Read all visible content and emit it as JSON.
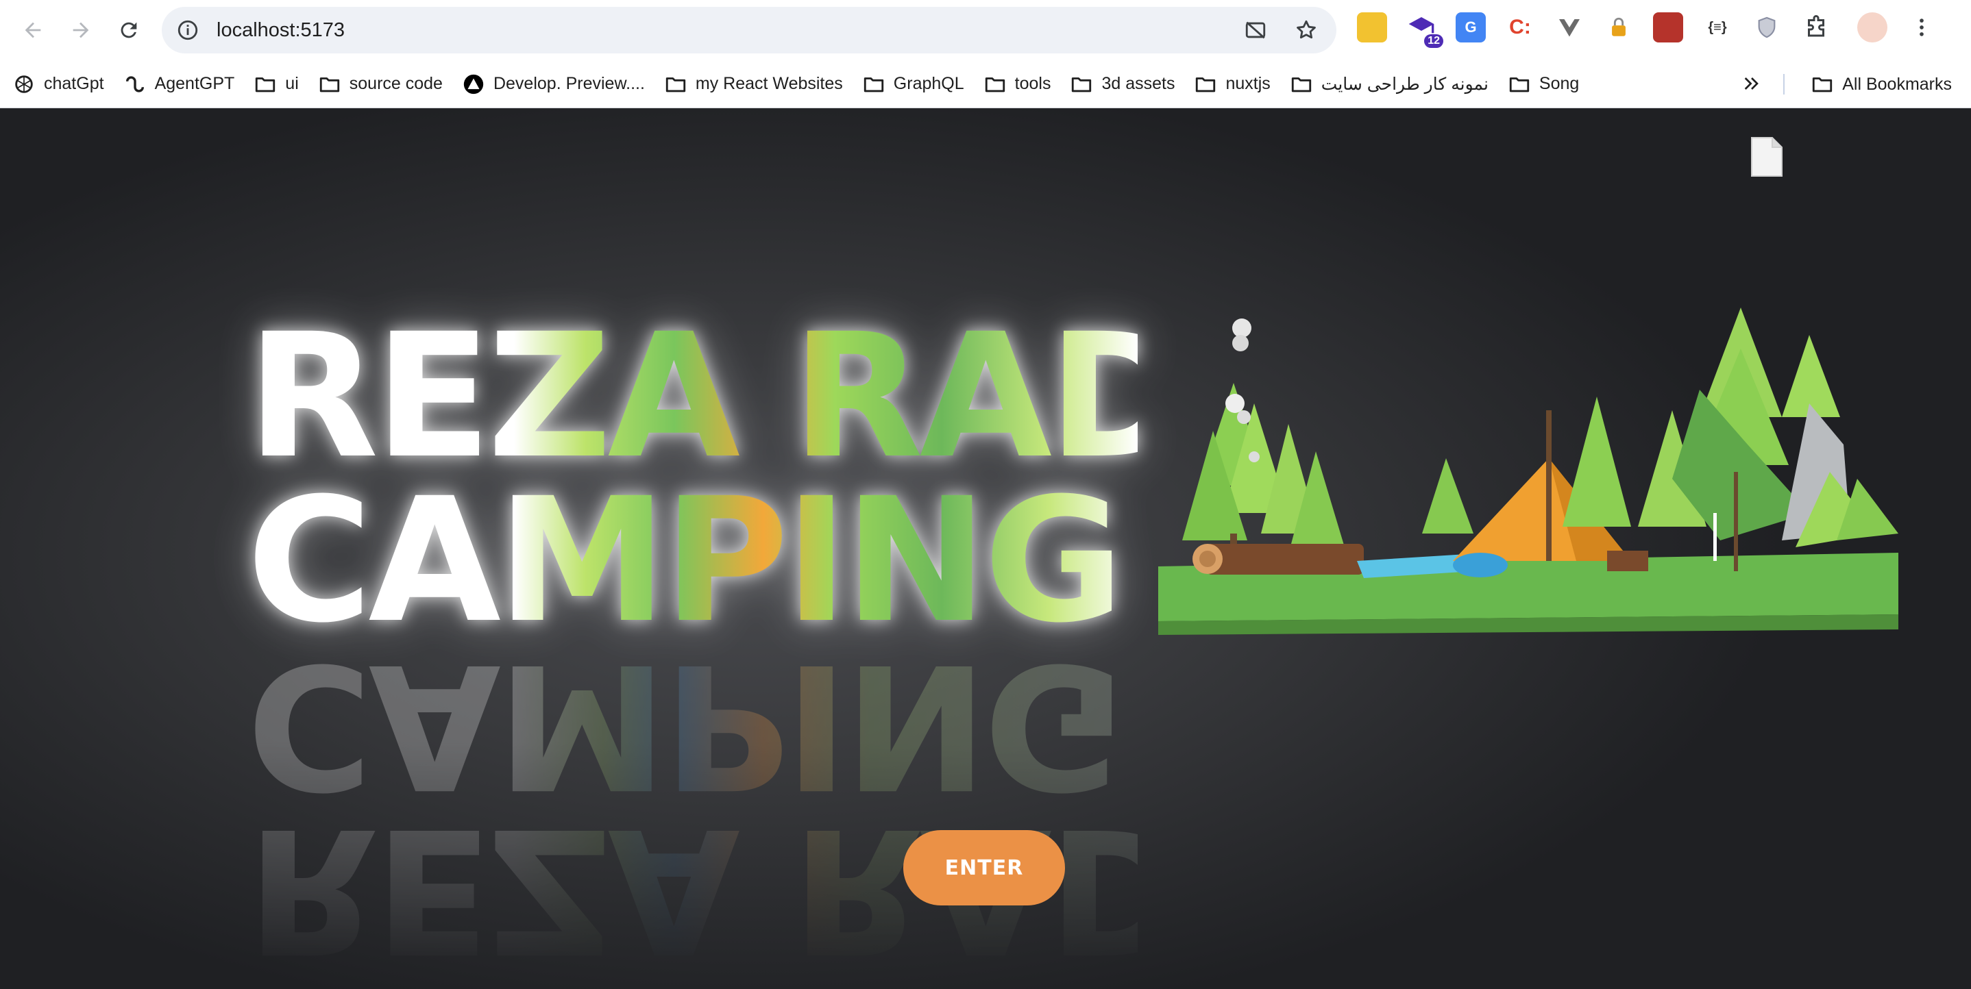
{
  "browser": {
    "url": "localhost:5173",
    "extensions": [
      {
        "name": "keep-extension-icon",
        "color": "#f2c230"
      },
      {
        "name": "graduation-extension-icon",
        "color": "#4e2bb5",
        "badge": "12"
      },
      {
        "name": "translate-extension-icon",
        "color": "#4285f4"
      },
      {
        "name": "c-extension-icon",
        "color": "#e0442e",
        "label": "C:"
      },
      {
        "name": "vue-extension-icon",
        "color": "#6b6b6b"
      },
      {
        "name": "lock-extension-icon",
        "color": "#e8a219"
      },
      {
        "name": "red-extension-icon",
        "color": "#b5332b"
      },
      {
        "name": "json-extension-icon",
        "color": "#333333",
        "label": "{≡}"
      },
      {
        "name": "shield-extension-icon",
        "color": "#8a8fa3"
      }
    ]
  },
  "bookmarks": {
    "items": [
      {
        "label": "chatGpt",
        "icon": "openai-icon"
      },
      {
        "label": "AgentGPT",
        "icon": "agent-icon"
      },
      {
        "label": "ui",
        "icon": "folder-icon"
      },
      {
        "label": "source code",
        "icon": "folder-icon"
      },
      {
        "label": "Develop. Preview....",
        "icon": "vercel-icon"
      },
      {
        "label": "my React Websites",
        "icon": "folder-icon"
      },
      {
        "label": "GraphQL",
        "icon": "folder-icon"
      },
      {
        "label": "tools",
        "icon": "folder-icon"
      },
      {
        "label": "3d assets",
        "icon": "folder-icon"
      },
      {
        "label": "nuxtjs",
        "icon": "folder-icon"
      },
      {
        "label": "نمونه کار طراحی سایت",
        "icon": "folder-icon"
      },
      {
        "label": "Song",
        "icon": "folder-icon"
      }
    ],
    "all_bookmarks": "All Bookmarks"
  },
  "page": {
    "title_line1": "REZA RAD",
    "title_line2": "CAMPING",
    "enter_label": "ENTER"
  }
}
